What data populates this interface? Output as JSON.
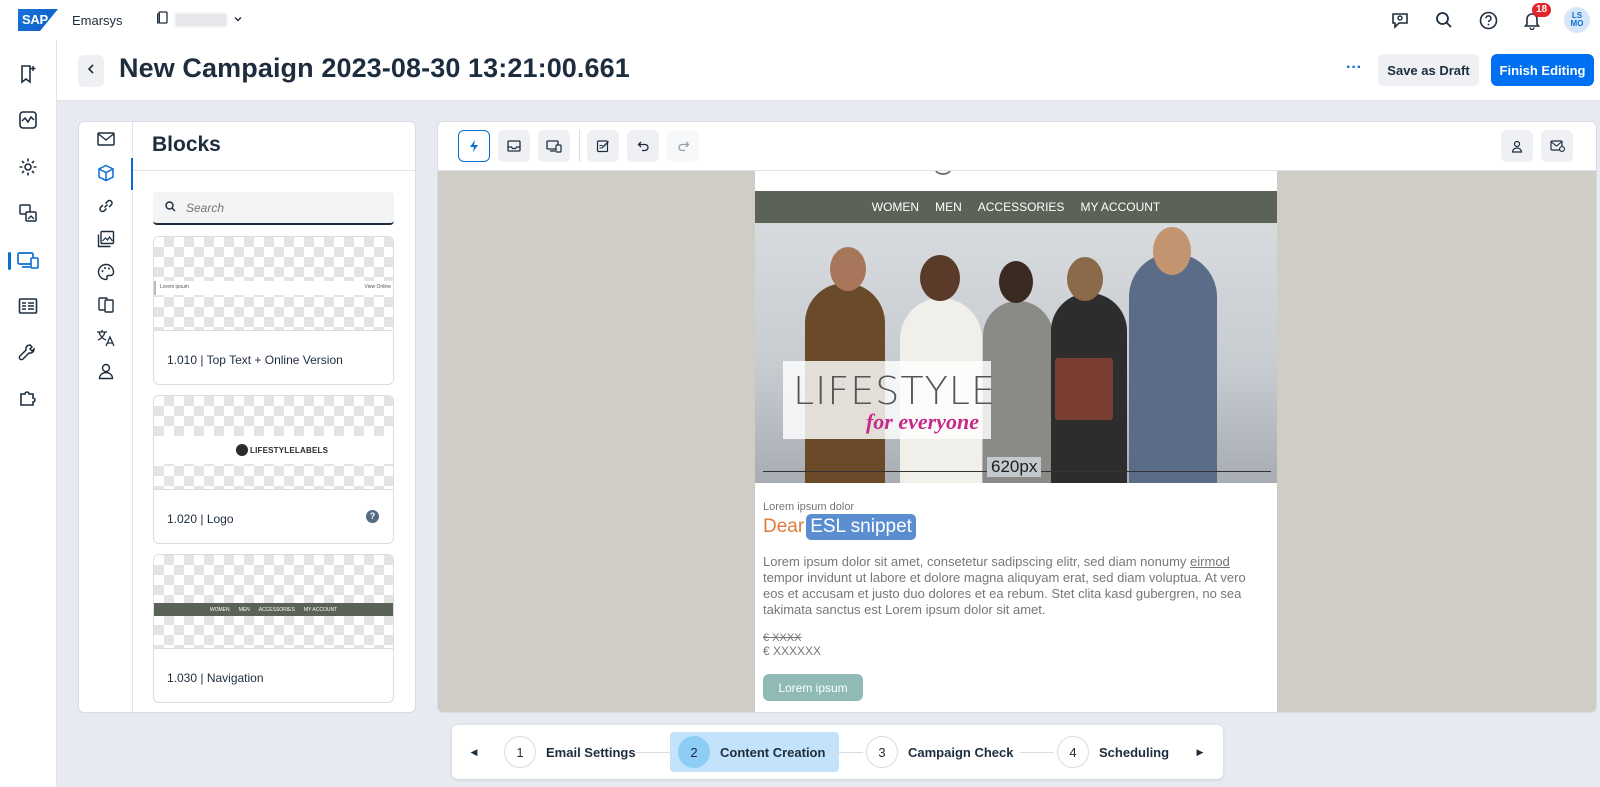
{
  "shell": {
    "logo_text": "SAP",
    "brand": "Emarsys",
    "notification_count": "18",
    "avatar_initials_top": "LS",
    "avatar_initials_bottom": "MO",
    "colors": {
      "accent": "#0070f2",
      "badge": "#e3242b"
    }
  },
  "left_nav": {
    "icons": [
      "bookmark-sparkle-icon",
      "analytics-icon",
      "settings-gear-icon",
      "media-icon",
      "responsive-devices-icon",
      "form-icon",
      "wrench-icon",
      "puzzle-icon"
    ],
    "active": "responsive-devices-icon"
  },
  "header": {
    "title": "New Campaign 2023-08-30 13:21:00.661",
    "more_label": "···",
    "save_draft_label": "Save as Draft",
    "finish_label": "Finish Editing"
  },
  "blocks": {
    "title": "Blocks",
    "search_placeholder": "Search",
    "tabs": [
      "mail-icon",
      "cube-icon",
      "link-icon",
      "images-icon",
      "palette-icon",
      "pages-icon",
      "translate-icon",
      "person-icon"
    ],
    "active_tab": "cube-icon",
    "cards": [
      {
        "label": "1.010 | Top Text + Online Version",
        "thumb_left": "Lorem ipsum",
        "thumb_right": "View Online"
      },
      {
        "label": "1.020 | Logo",
        "thumb_logo": "LIFESTYLELABELS",
        "help": "?"
      },
      {
        "label": "1.030 | Navigation",
        "thumb_nav": [
          "WOMEN",
          "MEN",
          "ACCESSORIES",
          "MY ACCOUNT"
        ]
      }
    ]
  },
  "editor": {
    "toolbar": [
      "lightning-icon",
      "inbox-preview-icon",
      "device-preview-icon",
      "edit-check-icon",
      "undo-icon",
      "redo-icon"
    ],
    "toolbar_right": [
      "personalization-icon",
      "test-mail-icon"
    ]
  },
  "email": {
    "nav": [
      "WOMEN",
      "MEN",
      "ACCESSORIES",
      "MY ACCOUNT"
    ],
    "hero_title": "LIFESTYLE",
    "hero_subtitle": "for everyone",
    "width_label": "620px",
    "pre_header": "Lorem ipsum dolor",
    "greeting": "Dear",
    "snippet": "ESL snippet",
    "body_before_link": "Lorem ipsum dolor sit amet, consetetur sadipscing elitr, sed diam nonumy ",
    "body_link": "eirmod",
    "body_after_link": " tempor invidunt ut labore et dolore magna aliquyam erat, sed diam voluptua. At vero eos et accusam et justo duo dolores et ea rebum. Stet clita kasd gubergren, no sea takimata sanctus est Lorem ipsum dolor sit amet.",
    "price_old": "€ XXXX",
    "price_new": "€ XXXXXX",
    "cta": "Lorem ipsum"
  },
  "stepper": {
    "steps": [
      {
        "num": "1",
        "label": "Email Settings"
      },
      {
        "num": "2",
        "label": "Content Creation"
      },
      {
        "num": "3",
        "label": "Campaign Check"
      },
      {
        "num": "4",
        "label": "Scheduling"
      }
    ],
    "active_step": 2
  }
}
